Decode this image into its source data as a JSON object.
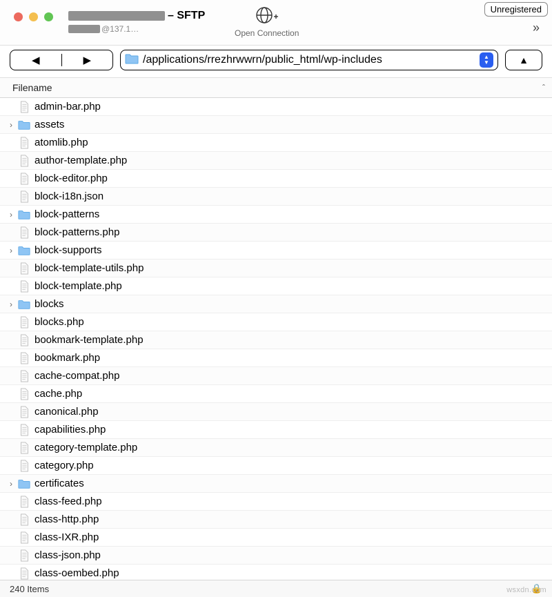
{
  "titlebar": {
    "protocol_suffix": "– SFTP",
    "ip_fragment": "@137.1…",
    "open_connection_label": "Open Connection",
    "unregistered_label": "Unregistered",
    "overflow_glyph": "»"
  },
  "toolbar": {
    "back_glyph": "◀",
    "fwd_glyph": "▶",
    "path": "/applications/rrezhrwwrn/public_html/wp-includes",
    "up_glyph": "▲"
  },
  "columns": {
    "filename_header": "Filename",
    "sort_glyph": "ˆ"
  },
  "files": [
    {
      "name": "admin-bar.php",
      "type": "file"
    },
    {
      "name": "assets",
      "type": "folder"
    },
    {
      "name": "atomlib.php",
      "type": "file"
    },
    {
      "name": "author-template.php",
      "type": "file"
    },
    {
      "name": "block-editor.php",
      "type": "file"
    },
    {
      "name": "block-i18n.json",
      "type": "file"
    },
    {
      "name": "block-patterns",
      "type": "folder"
    },
    {
      "name": "block-patterns.php",
      "type": "file"
    },
    {
      "name": "block-supports",
      "type": "folder"
    },
    {
      "name": "block-template-utils.php",
      "type": "file"
    },
    {
      "name": "block-template.php",
      "type": "file"
    },
    {
      "name": "blocks",
      "type": "folder"
    },
    {
      "name": "blocks.php",
      "type": "file"
    },
    {
      "name": "bookmark-template.php",
      "type": "file"
    },
    {
      "name": "bookmark.php",
      "type": "file"
    },
    {
      "name": "cache-compat.php",
      "type": "file"
    },
    {
      "name": "cache.php",
      "type": "file"
    },
    {
      "name": "canonical.php",
      "type": "file"
    },
    {
      "name": "capabilities.php",
      "type": "file"
    },
    {
      "name": "category-template.php",
      "type": "file"
    },
    {
      "name": "category.php",
      "type": "file"
    },
    {
      "name": "certificates",
      "type": "folder"
    },
    {
      "name": "class-feed.php",
      "type": "file"
    },
    {
      "name": "class-http.php",
      "type": "file"
    },
    {
      "name": "class-IXR.php",
      "type": "file"
    },
    {
      "name": "class-json.php",
      "type": "file"
    },
    {
      "name": "class-oembed.php",
      "type": "file"
    }
  ],
  "status": {
    "count_text": "240 Items",
    "lock_glyph": "🔒"
  },
  "watermark": "wsxdn.com"
}
